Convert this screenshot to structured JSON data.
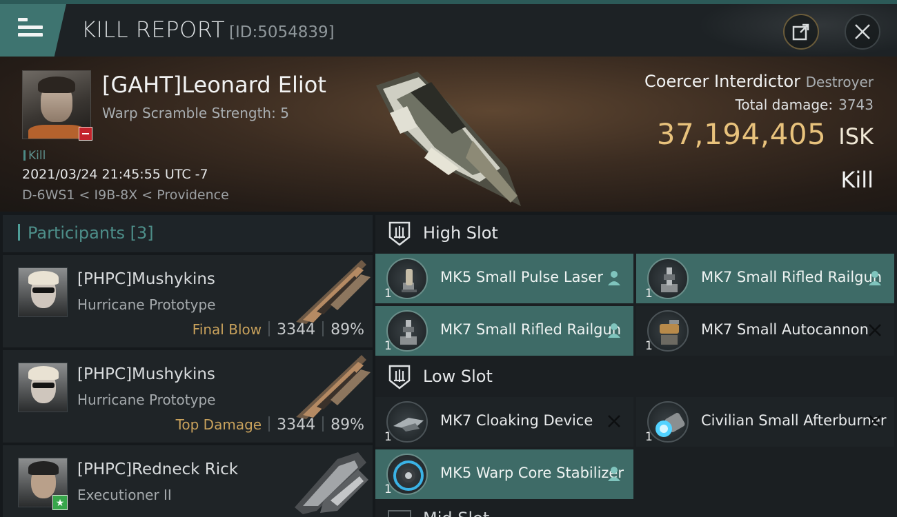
{
  "header": {
    "title": "KILL REPORT",
    "report_id": "[ID:5054839]",
    "menu_icon": "hamburger-icon",
    "share_icon": "share-icon",
    "close_icon": "close-icon"
  },
  "victim": {
    "name": "[GAHT]Leonard Eliot",
    "subtitle": "Warp Scramble Strength: 5",
    "kill_label": "Kill",
    "timestamp": "2021/03/24 21:45:55 UTC -7",
    "location": "D-6WS1 < I9B-8X < Providence",
    "ship_name": "Coercer Interdictor",
    "ship_class": "Destroyer",
    "total_damage_label": "Total damage:",
    "total_damage": "3743",
    "isk_value": "37,194,405",
    "isk_unit": "ISK",
    "result": "Kill"
  },
  "participants": {
    "label": "Participants",
    "count": "[3]",
    "rows": [
      {
        "name": "[PHPC]Mushykins",
        "ship": "Hurricane Prototype",
        "role": "Final Blow",
        "damage": "3344",
        "percent": "89%"
      },
      {
        "name": "[PHPC]Mushykins",
        "ship": "Hurricane Prototype",
        "role": "Top Damage",
        "damage": "3344",
        "percent": "89%"
      },
      {
        "name": "[PHPC]Redneck Rick",
        "ship": "Executioner II",
        "role": "",
        "damage": "",
        "percent": ""
      }
    ]
  },
  "fittings": {
    "high_slot": {
      "title": "High Slot",
      "modules": [
        {
          "name": "MK5 Small Pulse Laser",
          "qty": "1",
          "state": "pilot-icon",
          "active": true
        },
        {
          "name": "MK7 Small Rifled Railgun",
          "qty": "1",
          "state": "pilot-icon",
          "active": true
        },
        {
          "name": "MK7 Small Rifled Railgun",
          "qty": "1",
          "state": "pilot-icon",
          "active": true
        },
        {
          "name": "MK7 Small Autocannon",
          "qty": "1",
          "state": "destroyed-x-icon",
          "active": false
        }
      ]
    },
    "low_slot": {
      "title": "Low Slot",
      "modules": [
        {
          "name": "MK7 Cloaking Device",
          "qty": "1",
          "state": "destroyed-x-icon",
          "active": false
        },
        {
          "name": "Civilian Small Afterburner",
          "qty": "1",
          "state": "destroyed-x-icon",
          "active": false
        },
        {
          "name": "MK5 Warp Core Stabilizer",
          "qty": "1",
          "state": "pilot-icon",
          "active": true
        }
      ]
    },
    "next_slot_peek": "Mid Slot"
  },
  "colors": {
    "accent_teal": "#3e6b67",
    "isk_gold": "#e8c27c",
    "role_gold": "#c9a25c",
    "negative_red": "#c3232b"
  }
}
